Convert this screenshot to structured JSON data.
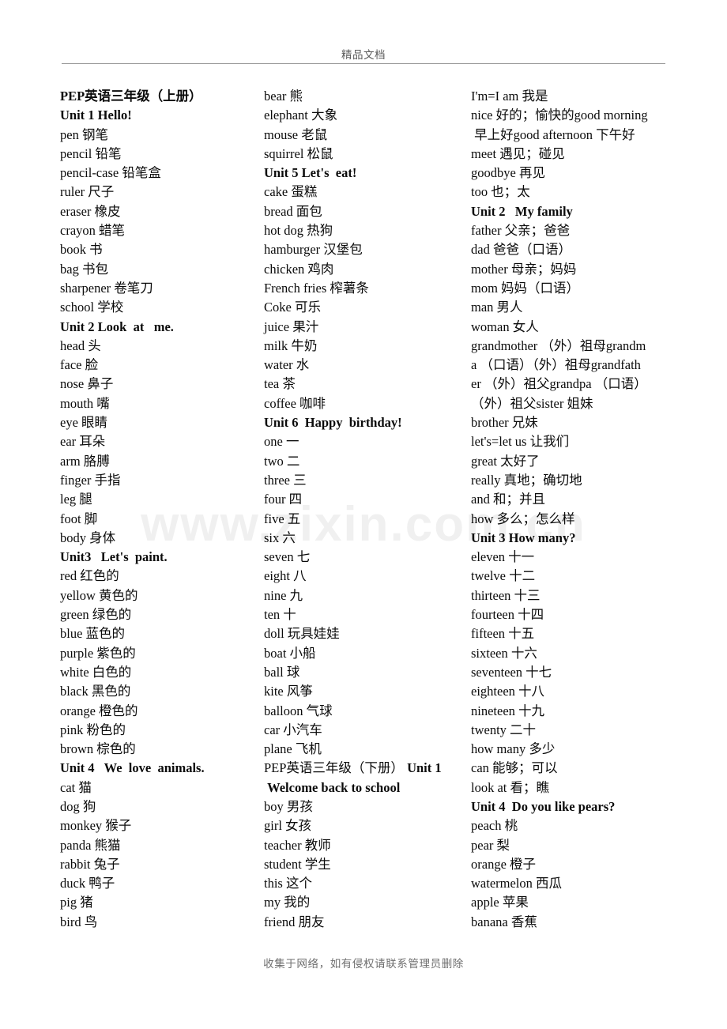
{
  "document": {
    "header_text": "精品文档",
    "footer_text": "收集于网络，如有侵权请联系管理员删除",
    "watermark_text": "www.zixin.com.cn"
  },
  "columns": [
    {
      "id": "column-left",
      "lines": [
        {
          "text": "PEP英语三年级（上册）",
          "bold": true
        },
        {
          "text": "Unit 1 Hello!",
          "bold": true
        },
        {
          "text": "pen 钢笔",
          "bold": false
        },
        {
          "text": "pencil 铅笔",
          "bold": false
        },
        {
          "text": "pencil-case 铅笔盒",
          "bold": false
        },
        {
          "text": "ruler 尺子",
          "bold": false
        },
        {
          "text": "eraser 橡皮",
          "bold": false
        },
        {
          "text": "crayon 蜡笔",
          "bold": false
        },
        {
          "text": "book 书",
          "bold": false
        },
        {
          "text": "bag 书包",
          "bold": false
        },
        {
          "text": "sharpener 卷笔刀",
          "bold": false
        },
        {
          "text": "school 学校",
          "bold": false
        },
        {
          "text": "Unit 2 Look  at   me.",
          "bold": true
        },
        {
          "text": "head 头",
          "bold": false
        },
        {
          "text": "face 脸",
          "bold": false
        },
        {
          "text": "nose 鼻子",
          "bold": false
        },
        {
          "text": "mouth 嘴",
          "bold": false
        },
        {
          "text": "eye 眼睛",
          "bold": false
        },
        {
          "text": "ear 耳朵",
          "bold": false
        },
        {
          "text": "arm 胳膊",
          "bold": false
        },
        {
          "text": "finger 手指",
          "bold": false
        },
        {
          "text": "leg 腿",
          "bold": false
        },
        {
          "text": "foot 脚",
          "bold": false
        },
        {
          "text": "body 身体",
          "bold": false
        },
        {
          "text": "Unit3   Let's  paint.",
          "bold": true
        },
        {
          "text": "red 红色的",
          "bold": false
        },
        {
          "text": "yellow 黄色的",
          "bold": false
        },
        {
          "text": "green 绿色的",
          "bold": false
        },
        {
          "text": "blue 蓝色的",
          "bold": false
        },
        {
          "text": "purple 紫色的",
          "bold": false
        },
        {
          "text": "white 白色的",
          "bold": false
        },
        {
          "text": "black 黑色的",
          "bold": false
        },
        {
          "text": "orange 橙色的",
          "bold": false
        },
        {
          "text": "pink 粉色的",
          "bold": false
        },
        {
          "text": "brown 棕色的",
          "bold": false
        },
        {
          "text": "Unit 4   We  love  animals.",
          "bold": true
        },
        {
          "text": "cat 猫",
          "bold": false
        },
        {
          "text": "dog 狗",
          "bold": false
        },
        {
          "text": "monkey 猴子",
          "bold": false
        },
        {
          "text": "panda 熊猫",
          "bold": false
        },
        {
          "text": "rabbit 兔子",
          "bold": false
        },
        {
          "text": "duck 鸭子",
          "bold": false
        },
        {
          "text": "pig 猪",
          "bold": false
        },
        {
          "text": "bird 鸟",
          "bold": false
        }
      ]
    },
    {
      "id": "column-middle",
      "lines": [
        {
          "text": "bear 熊",
          "bold": false
        },
        {
          "text": "elephant 大象",
          "bold": false
        },
        {
          "text": "mouse 老鼠",
          "bold": false
        },
        {
          "text": "squirrel 松鼠",
          "bold": false
        },
        {
          "text": "Unit 5 Let's  eat!",
          "bold": true
        },
        {
          "text": "cake 蛋糕",
          "bold": false
        },
        {
          "text": "bread 面包",
          "bold": false
        },
        {
          "text": "hot dog 热狗",
          "bold": false
        },
        {
          "text": "hamburger 汉堡包",
          "bold": false
        },
        {
          "text": "chicken 鸡肉",
          "bold": false
        },
        {
          "text": "French fries 榨薯条",
          "bold": false
        },
        {
          "text": "Coke 可乐",
          "bold": false
        },
        {
          "text": "juice 果汁",
          "bold": false
        },
        {
          "text": "milk 牛奶",
          "bold": false
        },
        {
          "text": "water 水",
          "bold": false
        },
        {
          "text": "tea 茶",
          "bold": false
        },
        {
          "text": "coffee 咖啡",
          "bold": false
        },
        {
          "text": "Unit 6  Happy  birthday!",
          "bold": true
        },
        {
          "text": "one 一",
          "bold": false
        },
        {
          "text": "two 二",
          "bold": false
        },
        {
          "text": "three 三",
          "bold": false
        },
        {
          "text": "four 四",
          "bold": false
        },
        {
          "text": "five 五",
          "bold": false
        },
        {
          "text": "six 六",
          "bold": false
        },
        {
          "text": "seven 七",
          "bold": false
        },
        {
          "text": "eight 八",
          "bold": false
        },
        {
          "text": "nine 九",
          "bold": false
        },
        {
          "text": "ten 十",
          "bold": false
        },
        {
          "text": "doll 玩具娃娃",
          "bold": false
        },
        {
          "text": "boat 小船",
          "bold": false
        },
        {
          "text": "ball 球",
          "bold": false
        },
        {
          "text": "kite 风筝",
          "bold": false
        },
        {
          "text": "balloon 气球",
          "bold": false
        },
        {
          "text": "car 小汽车",
          "bold": false
        },
        {
          "text": "plane 飞机",
          "bold": false
        },
        {
          "text": "PEP英语三年级（下册）",
          "bold": false,
          "suffix_bold": "Unit 1"
        },
        {
          "text": " Welcome back to school",
          "bold": true
        },
        {
          "text": "boy 男孩",
          "bold": false
        },
        {
          "text": "girl 女孩",
          "bold": false
        },
        {
          "text": "teacher 教师",
          "bold": false
        },
        {
          "text": "student 学生",
          "bold": false
        },
        {
          "text": "this 这个",
          "bold": false
        },
        {
          "text": "my 我的",
          "bold": false
        },
        {
          "text": "friend 朋友",
          "bold": false
        }
      ]
    },
    {
      "id": "column-right",
      "lines": [
        {
          "text": "I'm=I am 我是",
          "bold": false
        },
        {
          "text": "nice 好的；愉快的good morning",
          "bold": false
        },
        {
          "text": " 早上好good afternoon 下午好",
          "bold": false
        },
        {
          "text": "meet 遇见；碰见",
          "bold": false
        },
        {
          "text": "goodbye 再见",
          "bold": false
        },
        {
          "text": "too 也；太",
          "bold": false
        },
        {
          "text": "Unit 2   My family",
          "bold": true
        },
        {
          "text": "father 父亲；爸爸",
          "bold": false
        },
        {
          "text": "dad 爸爸（口语）",
          "bold": false
        },
        {
          "text": "mother 母亲；妈妈",
          "bold": false
        },
        {
          "text": "mom 妈妈（口语）",
          "bold": false
        },
        {
          "text": "man 男人",
          "bold": false
        },
        {
          "text": "woman 女人",
          "bold": false
        },
        {
          "text": "grandmother （外）祖母grandm",
          "bold": false
        },
        {
          "text": "a （口语）（外）祖母grandfath",
          "bold": false
        },
        {
          "text": "er （外）祖父grandpa （口语）",
          "bold": false
        },
        {
          "text": "（外）祖父sister 姐妹",
          "bold": false
        },
        {
          "text": "brother 兄妹",
          "bold": false
        },
        {
          "text": "let's=let us 让我们",
          "bold": false
        },
        {
          "text": "great 太好了",
          "bold": false
        },
        {
          "text": "really 真地；确切地",
          "bold": false
        },
        {
          "text": "and 和；并且",
          "bold": false
        },
        {
          "text": "how 多么；怎么样",
          "bold": false
        },
        {
          "text": "Unit 3 How many?",
          "bold": true
        },
        {
          "text": "eleven 十一",
          "bold": false
        },
        {
          "text": "twelve 十二",
          "bold": false
        },
        {
          "text": "thirteen 十三",
          "bold": false
        },
        {
          "text": "fourteen 十四",
          "bold": false
        },
        {
          "text": "fifteen 十五",
          "bold": false
        },
        {
          "text": "sixteen 十六",
          "bold": false
        },
        {
          "text": "seventeen 十七",
          "bold": false
        },
        {
          "text": "eighteen 十八",
          "bold": false
        },
        {
          "text": "nineteen 十九",
          "bold": false
        },
        {
          "text": "twenty 二十",
          "bold": false
        },
        {
          "text": "how many 多少",
          "bold": false
        },
        {
          "text": "can 能够；可以",
          "bold": false
        },
        {
          "text": "look at 看；瞧",
          "bold": false
        },
        {
          "text": "Unit 4  Do you like pears?",
          "bold": true
        },
        {
          "text": "peach 桃",
          "bold": false
        },
        {
          "text": "pear 梨",
          "bold": false
        },
        {
          "text": "orange 橙子",
          "bold": false
        },
        {
          "text": "watermelon 西瓜",
          "bold": false
        },
        {
          "text": "apple 苹果",
          "bold": false
        },
        {
          "text": "banana 香蕉",
          "bold": false
        }
      ]
    }
  ]
}
